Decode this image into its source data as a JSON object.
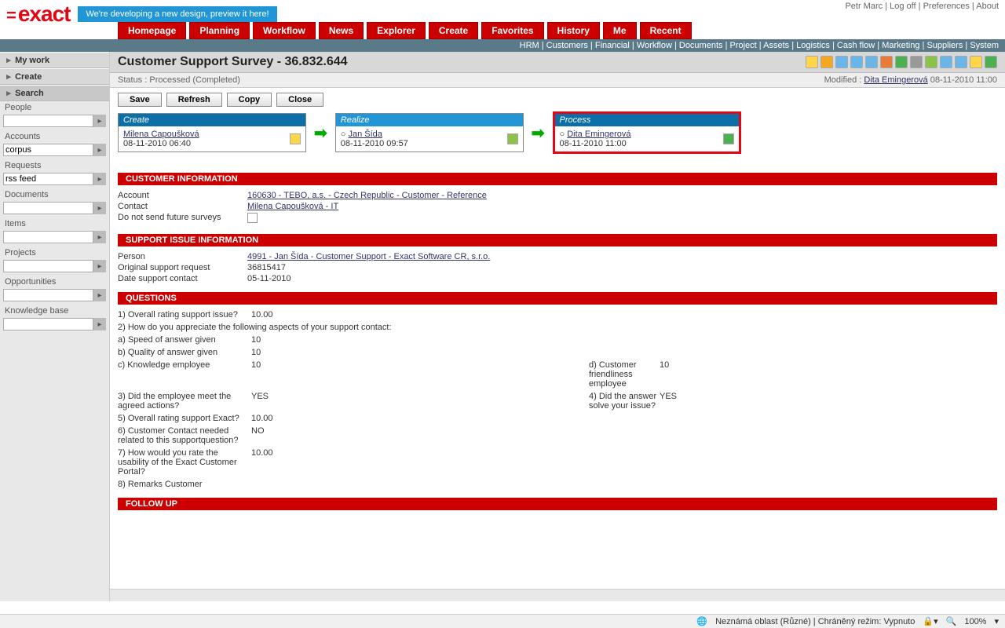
{
  "top": {
    "logo_text": "exact",
    "preview_banner": "We're developing a new design, preview it here!",
    "user": "Petr Marc",
    "logoff": "Log off",
    "prefs": "Preferences",
    "about": "About"
  },
  "nav": [
    "Homepage",
    "Planning",
    "Workflow",
    "News",
    "Explorer",
    "Create",
    "Favorites",
    "History",
    "Me",
    "Recent"
  ],
  "subnav": [
    "HRM",
    "Customers",
    "Financial",
    "Workflow",
    "Documents",
    "Project",
    "Assets",
    "Logistics",
    "Cash flow",
    "Marketing",
    "Suppliers",
    "System"
  ],
  "sidebar": {
    "mywork": "My work",
    "create": "Create",
    "search": "Search",
    "people": "People",
    "accounts": "Accounts",
    "accounts_val": "corpus",
    "requests": "Requests",
    "requests_val": "rss feed",
    "documents": "Documents",
    "items": "Items",
    "projects": "Projects",
    "opportunities": "Opportunities",
    "knowledge": "Knowledge base"
  },
  "page": {
    "title": "Customer Support Survey - 36.832.644",
    "status_label": "Status :",
    "status_value": "Processed (Completed)",
    "modified_label": "Modified :",
    "modified_user": "Dita Emingerová",
    "modified_date": "08-11-2010 11:00"
  },
  "buttons": {
    "save": "Save",
    "refresh": "Refresh",
    "copy": "Copy",
    "close": "Close"
  },
  "workflow": {
    "create": {
      "title": "Create",
      "user": "Milena Capoušková",
      "date": "08-11-2010 06:40"
    },
    "realize": {
      "title": "Realize",
      "user": "Jan Šída",
      "date": "08-11-2010 09:57"
    },
    "process": {
      "title": "Process",
      "user": "Dita Emingerová",
      "date": "08-11-2010 11:00"
    }
  },
  "sections": {
    "customer": "CUSTOMER INFORMATION",
    "support": "SUPPORT ISSUE INFORMATION",
    "questions": "QUESTIONS",
    "followup": "FOLLOW UP"
  },
  "customer": {
    "account_lbl": "Account",
    "account_val": "160630 - TEBO, a.s. - Czech Republic - Customer - Reference",
    "contact_lbl": "Contact",
    "contact_val": "Milena Capoušková - IT",
    "nosurvey_lbl": "Do not send future surveys"
  },
  "support": {
    "person_lbl": "Person",
    "person_val": "4991 - Jan Šída - Customer Support - Exact Software CR, s.r.o.",
    "orig_lbl": "Original support request",
    "orig_val": "36815417",
    "date_lbl": "Date support contact",
    "date_val": "05-11-2010"
  },
  "questions": {
    "q1": "1) Overall rating support issue?",
    "q1v": "10.00",
    "q2": "2) How do you appreciate the following aspects of your support contact:",
    "qa": "a) Speed of answer given",
    "qav": "10",
    "qb": "b) Quality of answer given",
    "qbv": "10",
    "qc": "c) Knowledge employee",
    "qcv": "10",
    "qd": "d) Customer friendliness employee",
    "qdv": "10",
    "q3": "3) Did the employee meet the agreed actions?",
    "q3v": "YES",
    "q4": "4) Did the answer solve your issue?",
    "q4v": "YES",
    "q5": "5) Overall rating support Exact?",
    "q5v": "10.00",
    "q6": "6) Customer Contact needed related to this supportquestion?",
    "q6v": "NO",
    "q7": "7) How would you rate the usability of the Exact Customer Portal?",
    "q7v": "10.00",
    "q8": "8) Remarks Customer"
  },
  "footer": {
    "zone": "Neznámá oblast (Různé) | Chráněný režim: Vypnuto",
    "zoom": "100%"
  }
}
